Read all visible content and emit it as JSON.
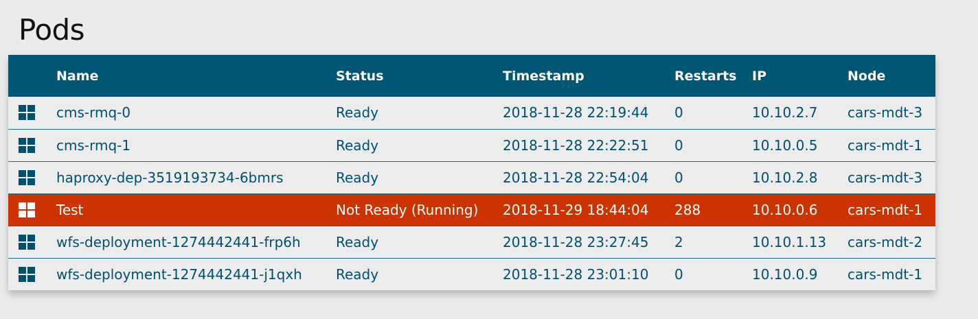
{
  "page": {
    "title": "Pods"
  },
  "table": {
    "columns": [
      "Name",
      "Status",
      "Timestamp",
      "Restarts",
      "IP",
      "Node"
    ],
    "rows": [
      {
        "name": "cms-rmq-0",
        "status": "Ready",
        "timestamp": "2018-11-28 22:19:44",
        "restarts": "0",
        "ip": "10.10.2.7",
        "node": "cars-mdt-3",
        "state": "ready",
        "icon": "grid-icon"
      },
      {
        "name": "cms-rmq-1",
        "status": "Ready",
        "timestamp": "2018-11-28 22:22:51",
        "restarts": "0",
        "ip": "10.10.0.5",
        "node": "cars-mdt-1",
        "state": "ready",
        "icon": "grid-icon"
      },
      {
        "name": "haproxy-dep-3519193734-6bmrs",
        "status": "Ready",
        "timestamp": "2018-11-28 22:54:04",
        "restarts": "0",
        "ip": "10.10.2.8",
        "node": "cars-mdt-3",
        "state": "ready",
        "icon": "grid-icon"
      },
      {
        "name": "Test",
        "status": "Not Ready (Running)",
        "timestamp": "2018-11-29 18:44:04",
        "restarts": "288",
        "ip": "10.10.0.6",
        "node": "cars-mdt-1",
        "state": "not-ready",
        "icon": "grid-icon"
      },
      {
        "name": "wfs-deployment-1274442441-frp6h",
        "status": "Ready",
        "timestamp": "2018-11-28 23:27:45",
        "restarts": "2",
        "ip": "10.10.1.13",
        "node": "cars-mdt-2",
        "state": "ready",
        "icon": "grid-icon"
      },
      {
        "name": "wfs-deployment-1274442441-j1qxh",
        "status": "Ready",
        "timestamp": "2018-11-28 23:01:10",
        "restarts": "0",
        "ip": "10.10.0.9",
        "node": "cars-mdt-1",
        "state": "ready",
        "icon": "grid-icon"
      }
    ]
  },
  "colors": {
    "header_background": "#005673",
    "row_text": "#00506b",
    "error_row_background": "#cc3300",
    "page_background": "#ebebeb"
  }
}
